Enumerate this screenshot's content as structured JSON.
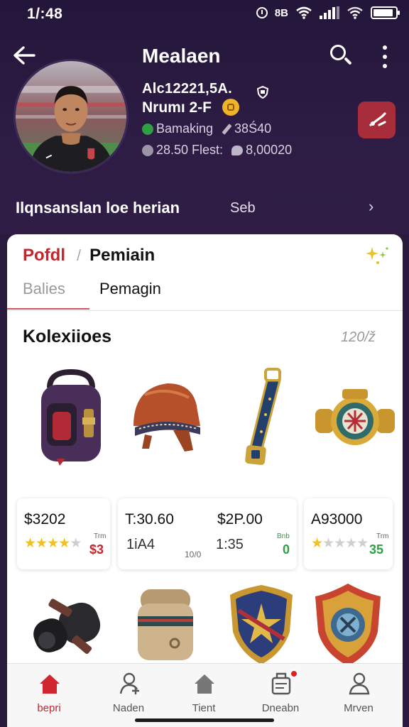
{
  "status_bar": {
    "time": "1/:48",
    "carrier_text": "8B",
    "battery_level": 0.9,
    "icons": [
      "alarm-icon",
      "wifi-icon",
      "signal-icon",
      "wifi-icon",
      "battery-icon"
    ]
  },
  "header": {
    "title": "Mealaen",
    "back_icon": "arrow-left-icon",
    "search_icon": "search-icon",
    "more_icon": "more-vertical-icon"
  },
  "profile": {
    "id": "Alc12221,5A.",
    "name": "Nrumı 2-F",
    "stats": [
      {
        "label": "Bamaking",
        "value": "38Ś40",
        "dot_color": "#2ea043"
      },
      {
        "label": "28.50 Flest:",
        "value": "8,00020",
        "dot_color": "#9a94a6"
      }
    ]
  },
  "section": {
    "title": "Ilqnsanslan loe herian",
    "link": "Seb",
    "chevron": "›"
  },
  "card": {
    "breadcrumb_home": "Pofdl",
    "breadcrumb_sep": "/",
    "breadcrumb_current": "Pemiain",
    "tabs": [
      "Balies",
      "Pemagin"
    ],
    "collection_title": "Kolexiioes",
    "collection_count": "120/ž"
  },
  "items": [
    {
      "name": "backpack",
      "price": "$3202",
      "rating": 4,
      "tiny": "Trm",
      "qty": "$3",
      "qty_color": "#c0282f"
    },
    {
      "name": "helmet",
      "price": "T:30.60",
      "sub": "1iA4",
      "sub2": "10/0"
    },
    {
      "name": "strap",
      "price": "$2P.00",
      "sub": "1:35",
      "tiny": "Bnb",
      "qty": "0",
      "qty_color": "#2ea043"
    },
    {
      "name": "medal",
      "price": "A93000",
      "rating": 1,
      "tiny": "Trm",
      "qty": "35",
      "qty_color": "#2ea043"
    }
  ],
  "items_row2": [
    "binoculars",
    "pouch",
    "shield-star",
    "shield-crest"
  ],
  "bottom_nav": [
    {
      "label": "bepri",
      "icon": "home-icon",
      "active": true
    },
    {
      "label": "Naden",
      "icon": "user-add-icon",
      "active": false
    },
    {
      "label": "Tient",
      "icon": "house-icon",
      "active": false
    },
    {
      "label": "Dneabn",
      "icon": "notification-icon",
      "active": false
    },
    {
      "label": "Mrven",
      "icon": "profile-icon",
      "active": false
    }
  ],
  "colors": {
    "accent": "#c0282f",
    "background": "#2a1a3e",
    "action_button": "#a82d3a",
    "star": "#f2c11b"
  }
}
